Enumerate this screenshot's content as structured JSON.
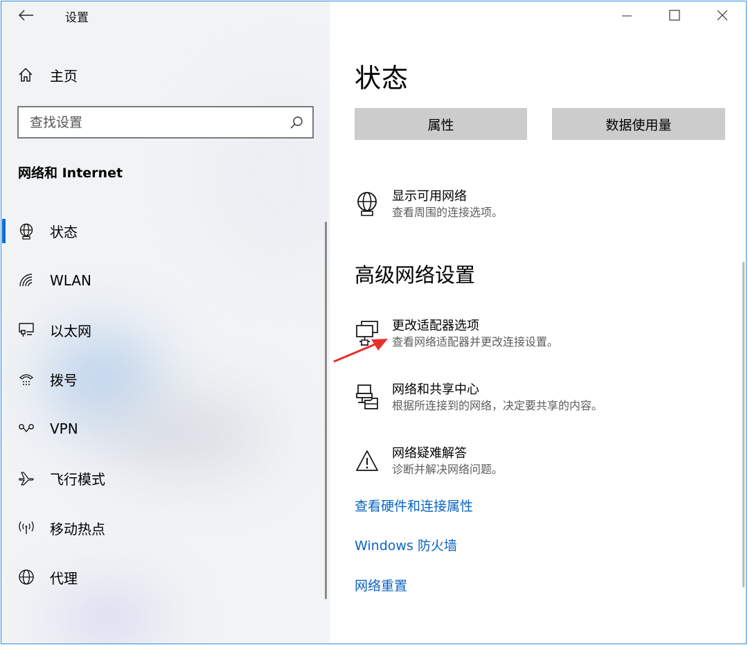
{
  "window": {
    "app_title": "设置",
    "back_icon": "back-arrow-icon",
    "controls": [
      "minimize-icon",
      "maximize-icon",
      "close-icon"
    ]
  },
  "sidebar": {
    "home_label": "主页",
    "search_placeholder": "查找设置",
    "section_title": "网络和 Internet",
    "items": [
      {
        "label": "状态",
        "icon": "globe-monitor-icon",
        "active": true
      },
      {
        "label": "WLAN",
        "icon": "wifi-icon",
        "active": false
      },
      {
        "label": "以太网",
        "icon": "ethernet-icon",
        "active": false
      },
      {
        "label": "拨号",
        "icon": "dialup-icon",
        "active": false
      },
      {
        "label": "VPN",
        "icon": "vpn-icon",
        "active": false
      },
      {
        "label": "飞行模式",
        "icon": "airplane-icon",
        "active": false
      },
      {
        "label": "移动热点",
        "icon": "hotspot-icon",
        "active": false
      },
      {
        "label": "代理",
        "icon": "globe-icon",
        "active": false
      }
    ]
  },
  "main": {
    "title": "状态",
    "buttons": {
      "properties": "属性",
      "data_usage": "数据使用量"
    },
    "show_networks": {
      "title": "显示可用网络",
      "desc": "查看周围的连接选项。"
    },
    "advanced_title": "高级网络设置",
    "advanced_items": [
      {
        "title": "更改适配器选项",
        "desc": "查看网络适配器并更改连接设置。",
        "icon": "adapter-icon"
      },
      {
        "title": "网络和共享中心",
        "desc": "根据所连接到的网络，决定要共享的内容。",
        "icon": "sharing-center-icon"
      },
      {
        "title": "网络疑难解答",
        "desc": "诊断并解决网络问题。",
        "icon": "warning-icon"
      }
    ],
    "links": [
      "查看硬件和连接属性",
      "Windows 防火墙",
      "网络重置"
    ]
  },
  "colors": {
    "accent": "#0a6fd1",
    "link": "#0a64c2",
    "button_bg": "#cccccc",
    "annotation_arrow": "#e8302a"
  }
}
